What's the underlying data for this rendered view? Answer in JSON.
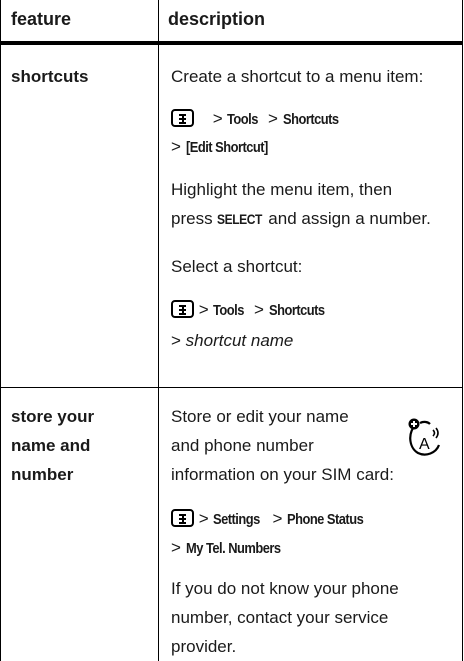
{
  "header": {
    "col_feature": "feature",
    "col_description": "description"
  },
  "rows": [
    {
      "feature": "shortcuts",
      "create_text": "Create a shortcut to a menu item:",
      "path1": {
        "sep": ">",
        "a": "Tools",
        "b": "Shortcuts",
        "c": "[Edit Shortcut]"
      },
      "highlight_line1": "Highlight the menu item, then",
      "highlight_line2_pre": "press",
      "highlight_select": "SELECT",
      "highlight_line2_post": "and assign a number.",
      "select_text": "Select a shortcut:",
      "path2": {
        "sep": ">",
        "a": "Tools",
        "b": "Shortcuts",
        "c": "shortcut name"
      }
    },
    {
      "feature_line1": "store your",
      "feature_line2": "name and",
      "feature_line3": "number",
      "store_line1": "Store or edit your name",
      "store_line2": "and phone number",
      "store_line3": "information on your SIM card:",
      "path": {
        "sep": ">",
        "a": "Settings",
        "b": "Phone Status",
        "c": "My Tel. Numbers"
      },
      "help_line1": "If you do not know your phone",
      "help_line2": "number, contact your service",
      "help_line3": "provider."
    }
  ],
  "icons": {
    "menu_key": "menu-key-icon",
    "sim_feature": "sim-dependent-feature-icon"
  }
}
